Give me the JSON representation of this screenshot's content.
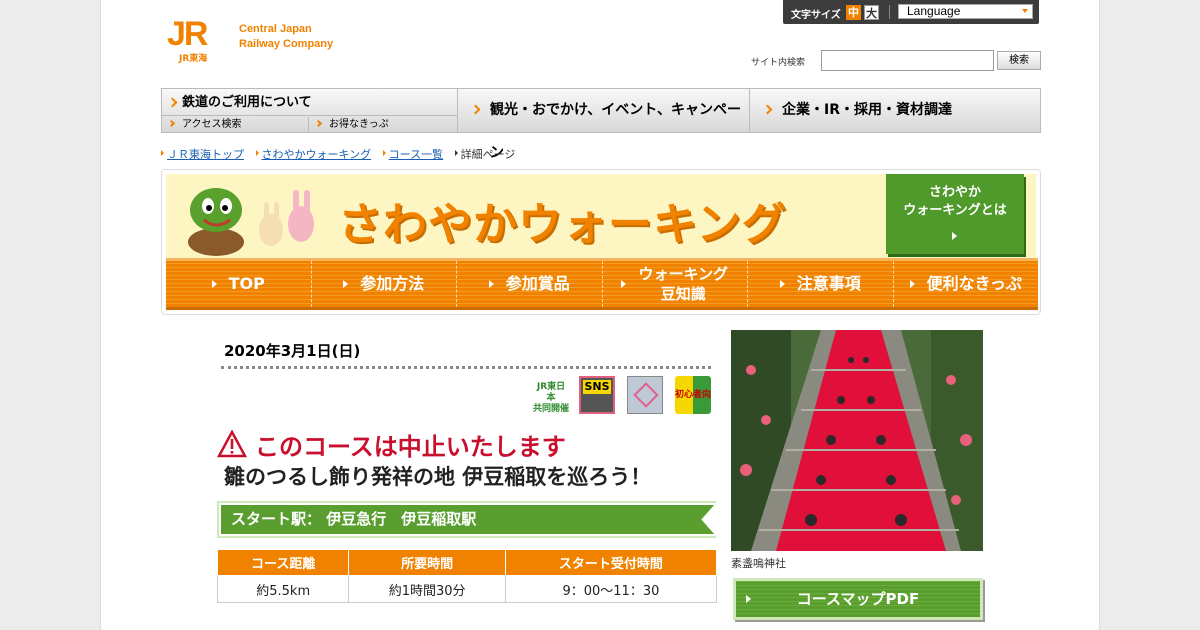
{
  "header": {
    "logo_mark": "JR",
    "logo_sub": "JR東海",
    "logo_name_line1": "Central Japan",
    "logo_name_line2": "Railway Company",
    "font_size_label": "文字サイズ",
    "font_size_medium": "中",
    "font_size_large": "大",
    "language_label": "Language",
    "search_label": "サイト内検索",
    "search_value": "",
    "search_button": "検索"
  },
  "global_nav": {
    "rail_main": "鉄道のご利用について",
    "rail_sub1": "アクセス検索",
    "rail_sub2": "お得なきっぷ",
    "tourism": "観光・おでかけ、イベント、キャンペーン",
    "corporate": "企業・IR・採用・資材調達"
  },
  "breadcrumb": {
    "items": [
      "ＪＲ東海トップ",
      "さわやかウォーキング",
      "コース一覧"
    ],
    "current": "詳細ページ"
  },
  "banner": {
    "title": "さわやかウォーキング",
    "about_line1": "さわやか",
    "about_line2": "ウォーキングとは",
    "nav": {
      "top": "TOP",
      "how": "参加方法",
      "prizes": "参加賞品",
      "tips_line1": "ウォーキング",
      "tips_line2": "豆知識",
      "cautions": "注意事項",
      "tickets": "便利なきっぷ"
    }
  },
  "event": {
    "date": "2020年3月1日(日)",
    "badges": {
      "jr_east_line1": "JR東日本",
      "jr_east_line2": "共同開催",
      "sns": "SNS",
      "beginner": "初心者向"
    },
    "cancel_notice": "このコースは中止いたします",
    "course_title": "雛のつるし飾り発祥の地 伊豆稲取を巡ろう！",
    "start_station": "スタート駅：  伊豆急行　伊豆稲取駅",
    "table": {
      "headers": [
        "コース距離",
        "所要時間",
        "スタート受付時間"
      ],
      "values": [
        "約5.5km",
        "約1時間30分",
        "9：00～11：30"
      ]
    },
    "photo_caption": "素盞嗚神社",
    "map_button": "コースマップPDF"
  },
  "colors": {
    "brand_orange": "#f08200",
    "green": "#5a9e2f",
    "alert_red": "#c8102e"
  }
}
